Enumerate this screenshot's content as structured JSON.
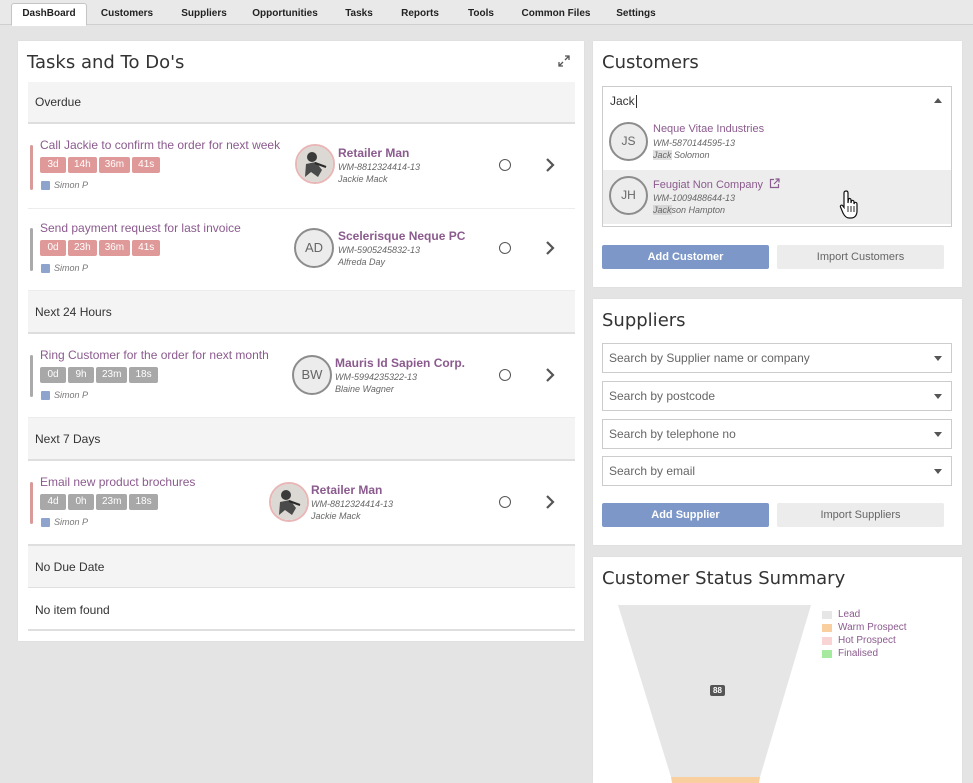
{
  "tabs": [
    {
      "label": "DashBoard",
      "active": true
    },
    {
      "label": "Customers"
    },
    {
      "label": "Suppliers"
    },
    {
      "label": "Opportunities"
    },
    {
      "label": "Tasks"
    },
    {
      "label": "Reports"
    },
    {
      "label": "Tools"
    },
    {
      "label": "Common Files"
    },
    {
      "label": "Settings"
    }
  ],
  "tasks_panel": {
    "title": "Tasks and To Do's",
    "sections": {
      "overdue": "Overdue",
      "next24": "Next 24 Hours",
      "next7": "Next 7 Days",
      "nodue": "No Due Date",
      "empty": "No item found"
    },
    "items": [
      {
        "title": "Call Jackie to confirm the order for next week",
        "chips": [
          "3d",
          "14h",
          "36m",
          "41s"
        ],
        "chip_color": "#e09999",
        "bar_color": "#d99a9a",
        "owner": "Simon P",
        "cust_name": "Retailer Man",
        "cust_id": "WM-8812324414-13",
        "cust_contact": "Jackie Mack"
      },
      {
        "title": "Send payment request for last invoice",
        "chips": [
          "0d",
          "23h",
          "36m",
          "41s"
        ],
        "chip_color": "#e09999",
        "bar_color": "#aaaaaa",
        "owner": "Simon P",
        "initials": "AD",
        "cust_name": "Scelerisque Neque PC",
        "cust_id": "WM-5905245832-13",
        "cust_contact": "Alfreda Day"
      },
      {
        "title": "Ring Customer for the order for next month",
        "chips": [
          "0d",
          "9h",
          "23m",
          "18s"
        ],
        "chip_color": "#a8a8a8",
        "bar_color": "#aaaaaa",
        "owner": "Simon P",
        "initials": "BW",
        "cust_name": "Mauris Id Sapien Corp.",
        "cust_id": "WM-5994235322-13",
        "cust_contact": "Blaine Wagner"
      },
      {
        "title": "Email new product brochures",
        "chips": [
          "4d",
          "0h",
          "23m",
          "18s"
        ],
        "chip_color": "#a8a8a8",
        "bar_color": "#d99a9a",
        "owner": "Simon P",
        "cust_name": "Retailer Man",
        "cust_id": "WM-8812324414-13",
        "cust_contact": "Jackie Mack"
      }
    ]
  },
  "customers_panel": {
    "title": "Customers",
    "search_value": "Jack",
    "results": [
      {
        "initials": "JS",
        "name": "Neque Vitae Industries",
        "id": "WM-5870144595-13",
        "contact": "Jack Solomon",
        "contact_match": "Jack",
        "contact_rest": " Solomon"
      },
      {
        "initials": "JH",
        "name": "Feugiat Non Company",
        "id": "WM-1009488644-13",
        "contact": "Jackson Hampton",
        "contact_match": "Jack",
        "contact_rest": "son Hampton"
      }
    ],
    "add_label": "Add Customer",
    "import_label": "Import Customers"
  },
  "suppliers_panel": {
    "title": "Suppliers",
    "search_name": "Search by Supplier name or company",
    "search_postcode": "Search by postcode",
    "search_phone": "Search by telephone no",
    "search_email": "Search by email",
    "add_label": "Add Supplier",
    "import_label": "Import Suppliers"
  },
  "status_panel": {
    "title": "Customer Status Summary",
    "legend": [
      {
        "label": "Lead",
        "color": "#e6e6e6"
      },
      {
        "label": "Warm Prospect",
        "color": "#f9cf9f"
      },
      {
        "label": "Hot Prospect",
        "color": "#f9d4d4"
      },
      {
        "label": "Finalised",
        "color": "#a6eaa0"
      }
    ],
    "badge": "88"
  },
  "colors": {
    "accent": "#8b5a8e",
    "primary_button": "#7d98c8"
  }
}
